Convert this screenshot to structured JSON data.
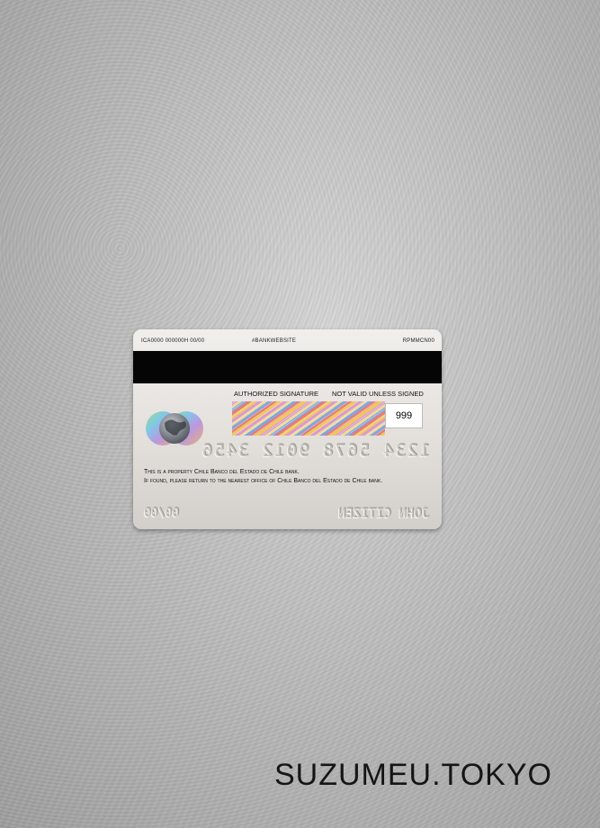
{
  "card": {
    "top_left_code": "ICA0000 000000H 00/00",
    "top_center": "#BANKWEBSITE",
    "top_right": "RPMMCN00",
    "signature_label": "AUTHORIZED SIGNATURE",
    "not_valid_label": "NOT VALID UNLESS SIGNED",
    "cvv": "999",
    "card_number": "1234 5678 9012 3456",
    "property_text": "This is a property Chile Banco del Estado de Chile bank.",
    "return_text": "If found, please return to the nearest office of Chile Banco del Estado de Chile bank.",
    "expiry": "00/00",
    "holder_name": "JOHN CITIZEN",
    "signature_panel_pattern": "MasterCard"
  },
  "watermark": "SUZUMEU.TOKYO",
  "colors": {
    "stripe": "#050505",
    "card_base": "#e3e0dc"
  }
}
